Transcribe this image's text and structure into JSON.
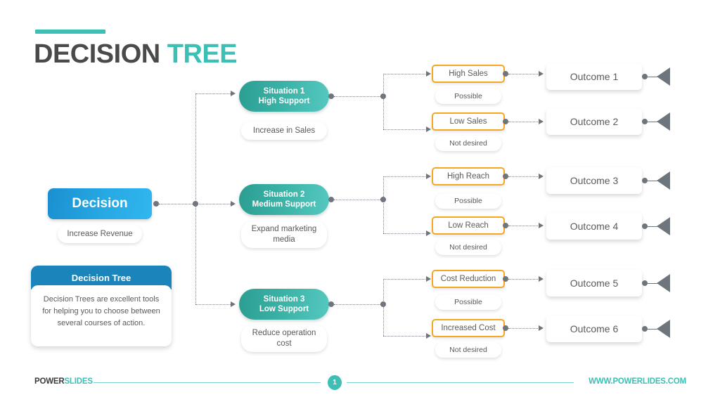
{
  "title": {
    "part1": "DECISION",
    "part2": "TREE"
  },
  "colors": {
    "accent_teal": "#3cbfb4",
    "decision_blue": "#27a9e3",
    "situation_teal": "#3cb3a7",
    "option_orange": "#f5a623",
    "text_gray": "#5b5b5d",
    "connector_gray": "#6f757c",
    "info_header_blue": "#1b85bb"
  },
  "decision": {
    "label": "Decision",
    "caption": "Increase Revenue"
  },
  "info_card": {
    "heading": "Decision Tree",
    "body": "Decision Trees are excellent tools for helping you to choose between several courses of action."
  },
  "branches": [
    {
      "situation_line1": "Situation 1",
      "situation_line2": "High Support",
      "situation_caption": "Increase in Sales",
      "options": [
        {
          "label": "High Sales",
          "note": "Possible",
          "outcome": "Outcome 1"
        },
        {
          "label": "Low Sales",
          "note": "Not desired",
          "outcome": "Outcome 2"
        }
      ]
    },
    {
      "situation_line1": "Situation 2",
      "situation_line2": "Medium Support",
      "situation_caption": "Expand marketing media",
      "options": [
        {
          "label": "High Reach",
          "note": "Possible",
          "outcome": "Outcome 3"
        },
        {
          "label": "Low Reach",
          "note": "Not desired",
          "outcome": "Outcome 4"
        }
      ]
    },
    {
      "situation_line1": "Situation 3",
      "situation_line2": "Low Support",
      "situation_caption": "Reduce operation cost",
      "options": [
        {
          "label": "Cost Reduction",
          "note": "Possible",
          "outcome": "Outcome 5"
        },
        {
          "label": "Increased Cost",
          "note": "Not desired",
          "outcome": "Outcome 6"
        }
      ]
    }
  ],
  "footer": {
    "logo_part1": "POWER",
    "logo_part2": "SLIDES",
    "page_number": "1",
    "url": "WWW.POWERLIDES.COM"
  }
}
